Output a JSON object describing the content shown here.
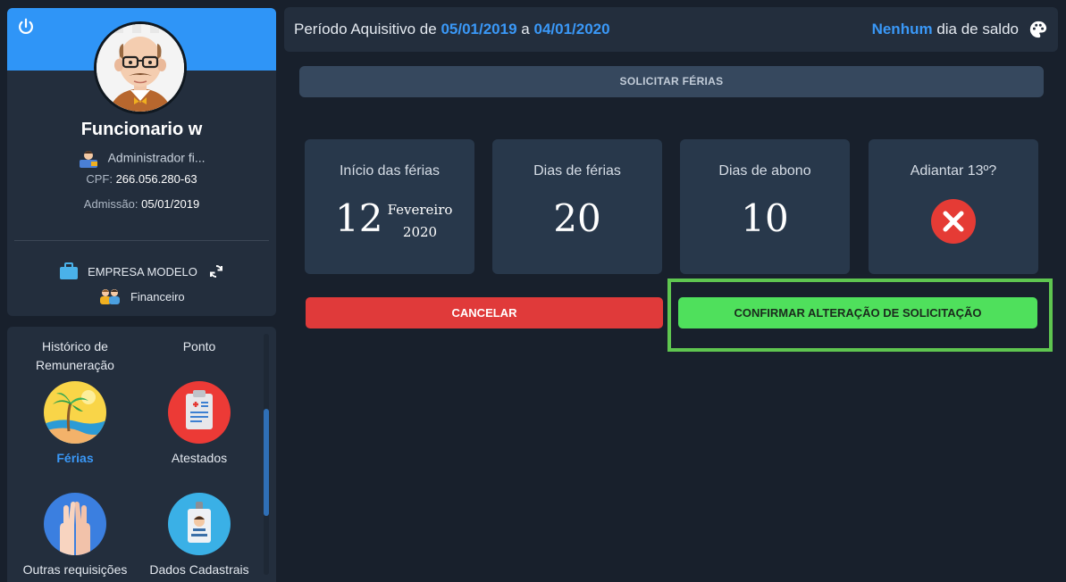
{
  "profile": {
    "name": "Funcionario w",
    "role": "Administrador fi...",
    "cpf_label": "CPF:",
    "cpf_value": "266.056.280-63",
    "admission_label": "Admissão:",
    "admission_value": "05/01/2019",
    "company": "EMPRESA MODELO",
    "department": "Financeiro"
  },
  "menu": {
    "headers": [
      "Histórico de\nRemuneração",
      "Ponto"
    ],
    "items": [
      {
        "label": "Férias",
        "active": true,
        "icon": "beach-icon"
      },
      {
        "label": "Atestados",
        "active": false,
        "icon": "medical-clipboard-icon"
      },
      {
        "label": "Outras requisições",
        "active": false,
        "icon": "raised-hands-icon"
      },
      {
        "label": "Dados Cadastrais",
        "active": false,
        "icon": "id-badge-icon"
      }
    ]
  },
  "top_bar": {
    "period_prefix": "Período Aquisitivo de",
    "period_start": "05/01/2019",
    "period_connector": "a",
    "period_end": "04/01/2020",
    "balance_highlight": "Nenhum",
    "balance_suffix": "dia de saldo"
  },
  "request_bar": {
    "label": "SOLICITAR FÉRIAS"
  },
  "stats": {
    "start": {
      "title": "Início das férias",
      "day": "12",
      "month": "Fevereiro",
      "year": "2020"
    },
    "days": {
      "title": "Dias de férias",
      "value": "20"
    },
    "bonus": {
      "title": "Dias de abono",
      "value": "10"
    },
    "advance": {
      "title": "Adiantar 13º?",
      "value": false
    }
  },
  "actions": {
    "cancel_label": "CANCELAR",
    "confirm_label": "CONFIRMAR ALTERAÇÃO DE SOLICITAÇÃO"
  },
  "colors": {
    "accent": "#2f95f7",
    "cancel": "#e03a3a",
    "confirm": "#4fe05c",
    "highlight_border": "#5fc650"
  }
}
